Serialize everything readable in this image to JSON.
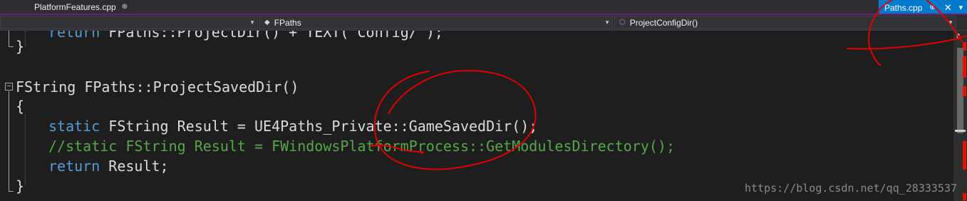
{
  "tabs": {
    "document_tab": "PlatformFeatures.cpp",
    "active_tab": "Paths.cpp",
    "pin_glyph": "⊕",
    "close_glyph": "✕",
    "menu_glyph": "▾"
  },
  "navigation": {
    "project_combo": "",
    "scope_combo": "FPaths",
    "member_combo": "ProjectConfigDir()",
    "dropdown_glyph": "▼"
  },
  "code": {
    "lines": [
      {
        "text_a": "return ",
        "text_b": "FPaths::ProjectDir() + TEXT(\"Config/\");"
      },
      {
        "text": "}"
      },
      {
        "text": "FString FPaths::ProjectSavedDir()"
      },
      {
        "text": "{"
      },
      {
        "kw": "static",
        "rest": " FString Result = UE4Paths_Private::GameSavedDir();"
      },
      {
        "text": "//static FString Result = FWindowsPlatformProcess::GetModulesDirectory();"
      },
      {
        "kw": "return",
        "rest": " Result;"
      },
      {
        "text": "}"
      }
    ],
    "fold_glyph": "−"
  },
  "watermark": "https://blog.csdn.net/qq_28333537",
  "colors": {
    "background": "#1e1e1e",
    "keyword": "#569cd6",
    "comment": "#57a64a",
    "text": "#dcdcdc",
    "accent_tab": "#007acc",
    "annotation": "#e00000"
  }
}
